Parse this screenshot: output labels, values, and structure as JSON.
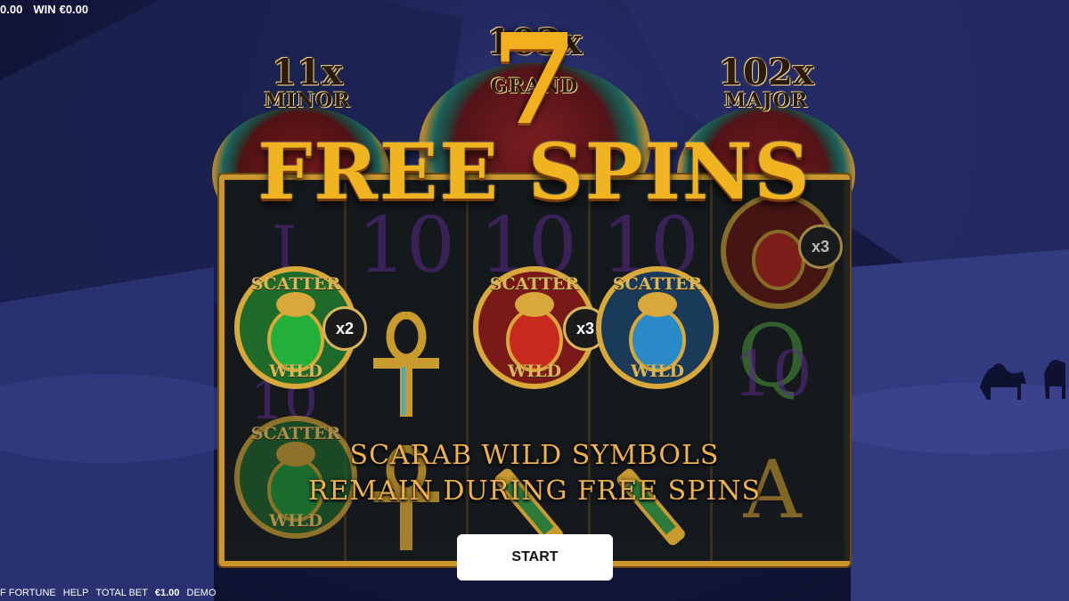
{
  "top_bar": {
    "balance_fragment": "0.00",
    "win_label": "WIN",
    "win_value": "€0.00"
  },
  "jackpots": {
    "minor": {
      "multiplier": "11x",
      "name": "MINOR"
    },
    "grand": {
      "multiplier": "103x",
      "name": "GRAND"
    },
    "major": {
      "multiplier": "102x",
      "name": "MAJOR"
    }
  },
  "overlay": {
    "spins_count": "7",
    "title": "FREE SPINS",
    "message_line1": "SCARAB WILD SYMBOLS",
    "message_line2": "REMAIN DURING FREE SPINS",
    "start_label": "START"
  },
  "scarabs": [
    {
      "label_top": "SCATTER",
      "label_bottom": "WILD",
      "multiplier": "x2",
      "color": "green"
    },
    {
      "label_top": "SCATTER",
      "label_bottom": "WILD",
      "multiplier": "x3",
      "color": "red"
    },
    {
      "label_top": "SCATTER",
      "label_bottom": "WILD",
      "multiplier": "",
      "color": "blue"
    },
    {
      "label_top": "SCATTER",
      "label_bottom": "WILD",
      "multiplier": "",
      "color": "green"
    },
    {
      "label_top": "",
      "label_bottom": "",
      "multiplier": "x3",
      "color": "red"
    }
  ],
  "reel_symbols": {
    "r1": [
      "J",
      "10"
    ],
    "r2": [
      "10"
    ],
    "r3": [
      "10"
    ],
    "r4": [
      "10"
    ],
    "r5": [
      "Q",
      "10",
      "A"
    ]
  },
  "bottom_bar": {
    "game_fragment": "F FORTUNE",
    "help_label": "HELP",
    "total_bet_label": "TOTAL BET",
    "total_bet_value": "€1.00",
    "mode_label": "DEMO"
  },
  "colors": {
    "gold": "#f0b420",
    "frame": "#c9962f",
    "start_bg": "#ffffff",
    "night": "#161a44"
  }
}
